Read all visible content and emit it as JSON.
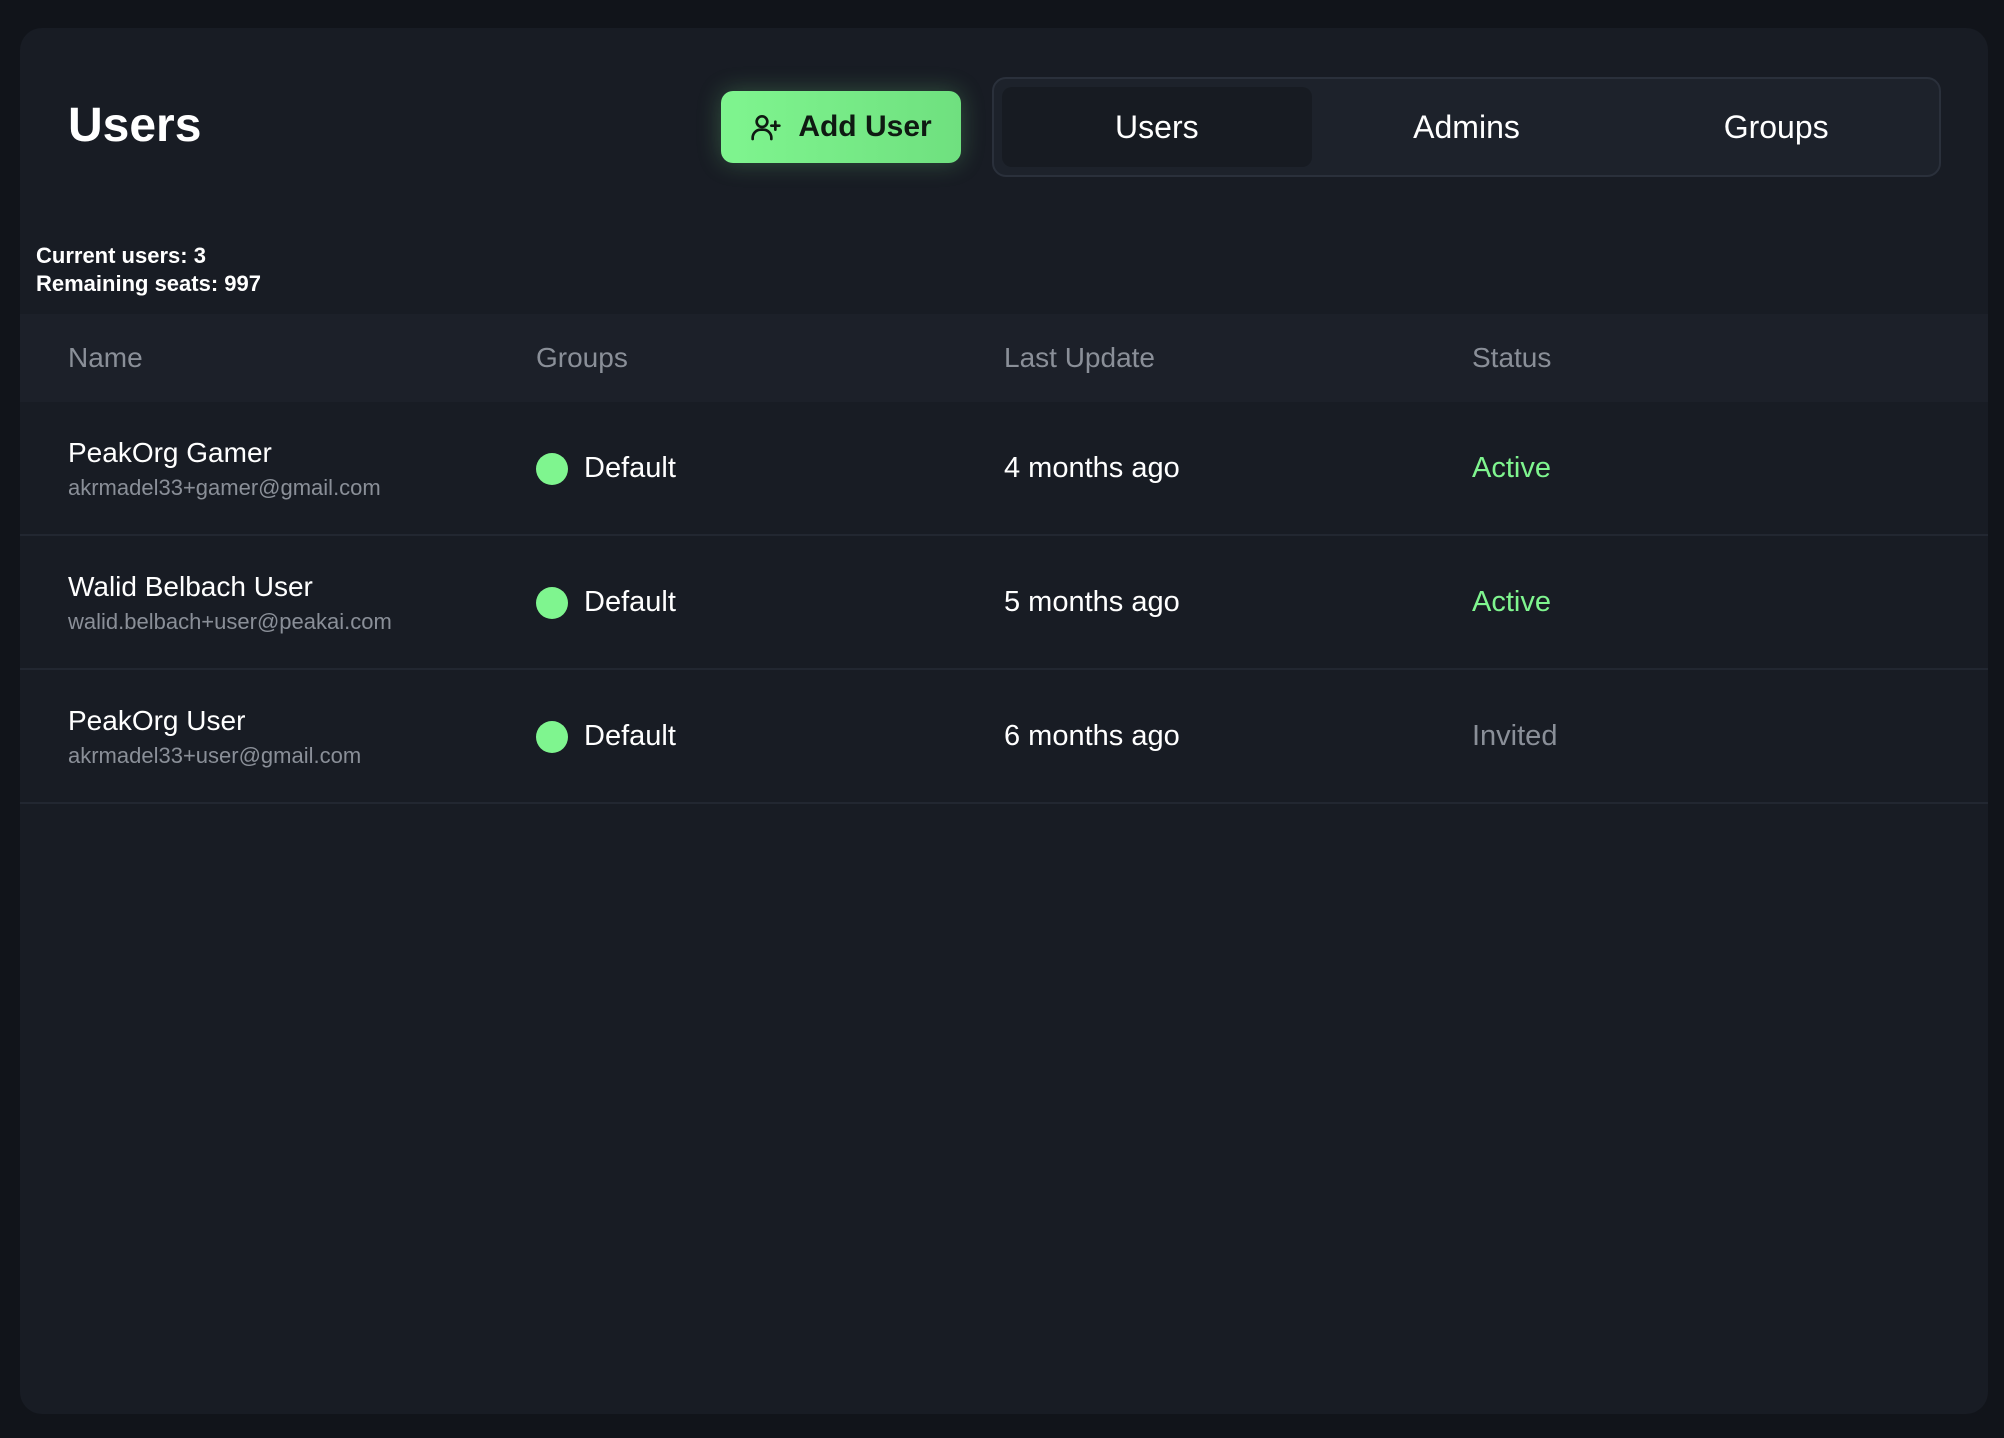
{
  "header": {
    "title": "Users",
    "add_user_label": "Add User"
  },
  "tabs": [
    {
      "label": "Users",
      "active": true
    },
    {
      "label": "Admins",
      "active": false
    },
    {
      "label": "Groups",
      "active": false
    }
  ],
  "seats": {
    "current_users": "Current users: 3",
    "remaining_seats": "Remaining seats: 997"
  },
  "table": {
    "columns": [
      "Name",
      "Groups",
      "Last Update",
      "Status"
    ],
    "rows": [
      {
        "name": "PeakOrg Gamer",
        "email": "akrmadel33+gamer@gmail.com",
        "group": "Default",
        "last_update": "4 months ago",
        "status": "Active"
      },
      {
        "name": "Walid Belbach User",
        "email": "walid.belbach+user@peakai.com",
        "group": "Default",
        "last_update": "5 months ago",
        "status": "Active"
      },
      {
        "name": "PeakOrg User",
        "email": "akrmadel33+user@gmail.com",
        "group": "Default",
        "last_update": "6 months ago",
        "status": "Invited"
      }
    ]
  },
  "colors": {
    "accent": "#7ff58f",
    "status_active": "#7ff58f",
    "status_invited": "#8a8f98",
    "group_default": "#7ff58f"
  },
  "icons": {
    "add_user": "user-plus-icon",
    "group_indicator": "circle-dot-icon"
  }
}
